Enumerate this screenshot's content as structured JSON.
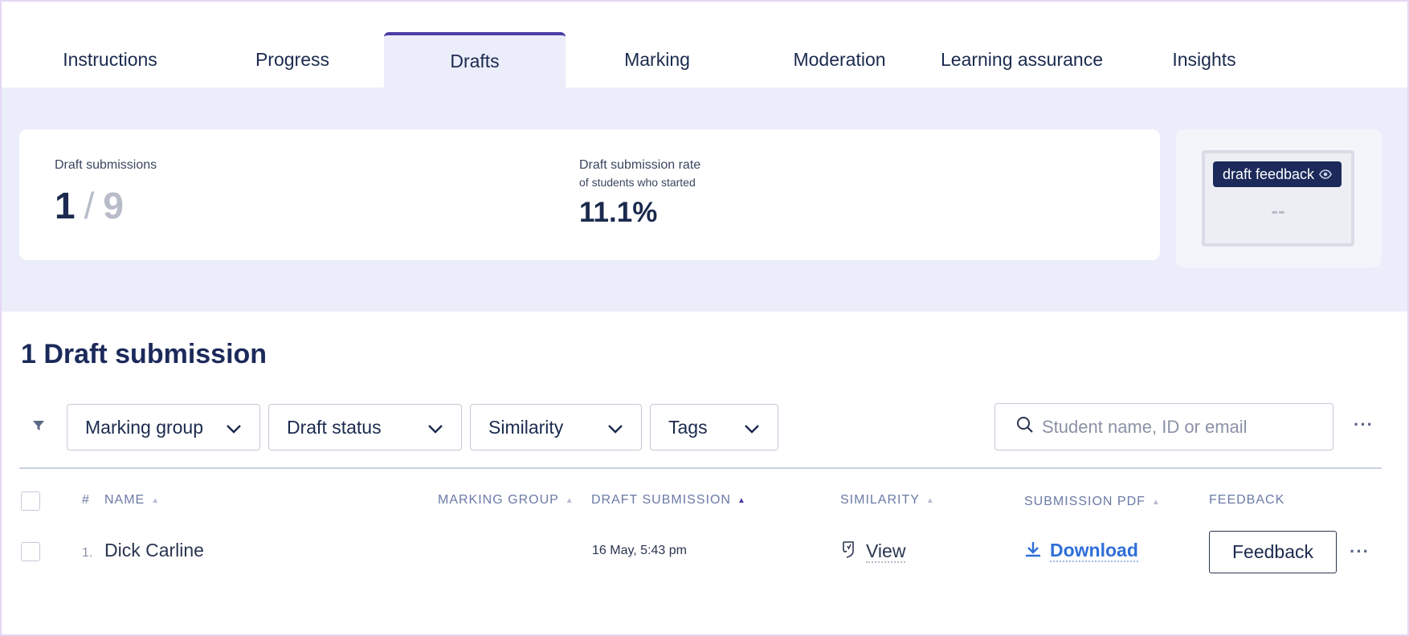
{
  "tabs": [
    {
      "label": "Instructions"
    },
    {
      "label": "Progress"
    },
    {
      "label": "Drafts"
    },
    {
      "label": "Marking"
    },
    {
      "label": "Moderation"
    },
    {
      "label": "Learning assurance"
    },
    {
      "label": "Insights"
    }
  ],
  "active_tab": "Drafts",
  "stats": {
    "draft_submissions_label": "Draft submissions",
    "draft_count": "1",
    "separator": "/",
    "total_count": "9",
    "rate_label": "Draft submission rate",
    "rate_sublabel": "of students who started",
    "rate_value": "11.1%"
  },
  "preview": {
    "badge_label": "draft feedback",
    "value": "--"
  },
  "section_title": "1 Draft submission",
  "filters": {
    "marking_group": "Marking group",
    "draft_status": "Draft status",
    "similarity": "Similarity",
    "tags": "Tags"
  },
  "search": {
    "placeholder": "Student name, ID or email"
  },
  "table": {
    "columns": {
      "num": "#",
      "name": "NAME",
      "marking_group": "MARKING GROUP",
      "draft_submission": "DRAFT SUBMISSION",
      "similarity": "SIMILARITY",
      "submission_pdf": "SUBMISSION PDF",
      "feedback": "FEEDBACK"
    },
    "rows": [
      {
        "num": "1.",
        "name": "Dick Carline",
        "marking_group": "",
        "draft_submission": "16 May, 5:43 pm",
        "similarity": "View",
        "submission_pdf": "Download",
        "feedback": "Feedback"
      }
    ]
  },
  "colors": {
    "accent": "#4b3fa6",
    "navy": "#1b2a5a",
    "link": "#2f6fd8",
    "band": "#ebedfa"
  }
}
